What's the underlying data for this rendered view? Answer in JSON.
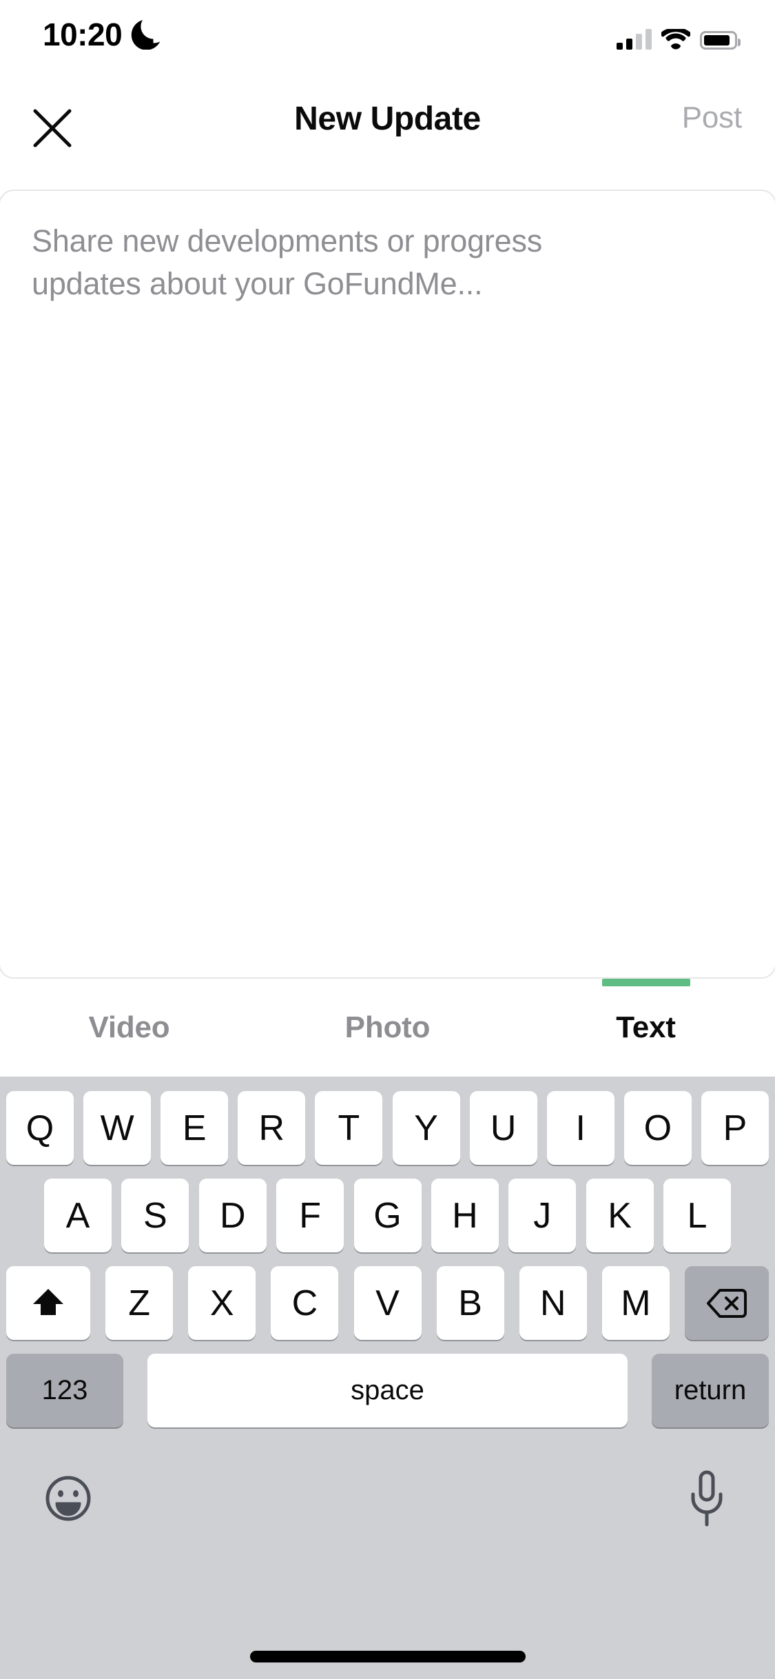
{
  "status_bar": {
    "time": "10:20",
    "dnd_icon": "crescent-moon-icon",
    "signal_icon": "cellular-signal-icon",
    "wifi_icon": "wifi-icon",
    "battery_icon": "battery-icon",
    "battery_level": 88
  },
  "nav": {
    "close_icon": "close-x-icon",
    "title": "New Update",
    "post_label": "Post",
    "post_enabled": false,
    "post_color": "#aaabae"
  },
  "composer": {
    "placeholder": "Share new developments or progress updates about your GoFundMe...",
    "value": "",
    "placeholder_color": "#8e8e93"
  },
  "tabs": {
    "active_index": 2,
    "indicator_color": "#5FBC82",
    "items": [
      {
        "label": "Video",
        "active": false
      },
      {
        "label": "Photo",
        "active": false
      },
      {
        "label": "Text",
        "active": true
      }
    ]
  },
  "keyboard": {
    "background": "#cfd0d4",
    "row1": [
      "Q",
      "W",
      "E",
      "R",
      "T",
      "Y",
      "U",
      "I",
      "O",
      "P"
    ],
    "row2": [
      "A",
      "S",
      "D",
      "F",
      "G",
      "H",
      "J",
      "K",
      "L"
    ],
    "row3": [
      "Z",
      "X",
      "C",
      "V",
      "B",
      "N",
      "M"
    ],
    "shift_icon": "shift-arrow-up-icon",
    "backspace_icon": "backspace-delete-icon",
    "numeric_label": "123",
    "space_label": "space",
    "return_label": "return",
    "emoji_icon": "emoji-smiley-icon",
    "dictation_icon": "microphone-icon"
  },
  "home_indicator": "home-indicator-bar"
}
